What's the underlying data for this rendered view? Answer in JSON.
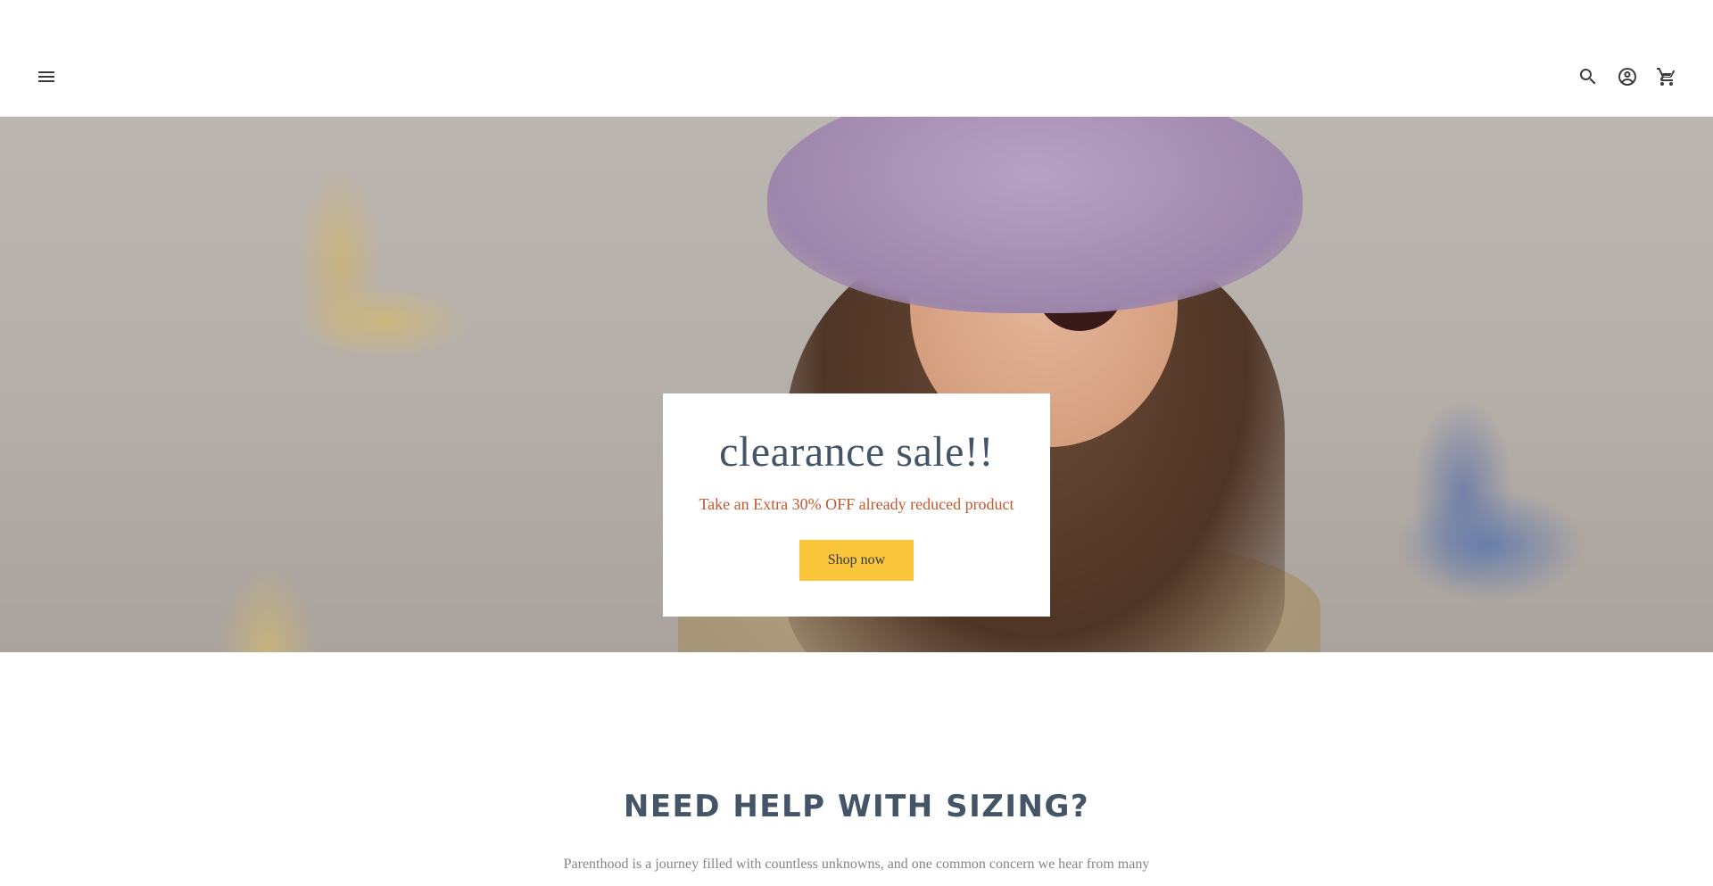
{
  "header": {
    "icons": {
      "menu": "menu-icon",
      "search": "search-icon",
      "account": "account-icon",
      "cart": "cart-icon"
    }
  },
  "hero": {
    "title": "clearance sale!!",
    "subtitle": "Take an Extra 30% OFF already reduced product",
    "button_label": "Shop now",
    "colors": {
      "title": "#435567",
      "subtitle": "#c4582e",
      "button": "#fbc53c"
    }
  },
  "sizing": {
    "title": "NEED HELP WITH SIZING?",
    "text": "Parenthood is a journey filled with countless unknowns, and one common concern we hear from many"
  }
}
